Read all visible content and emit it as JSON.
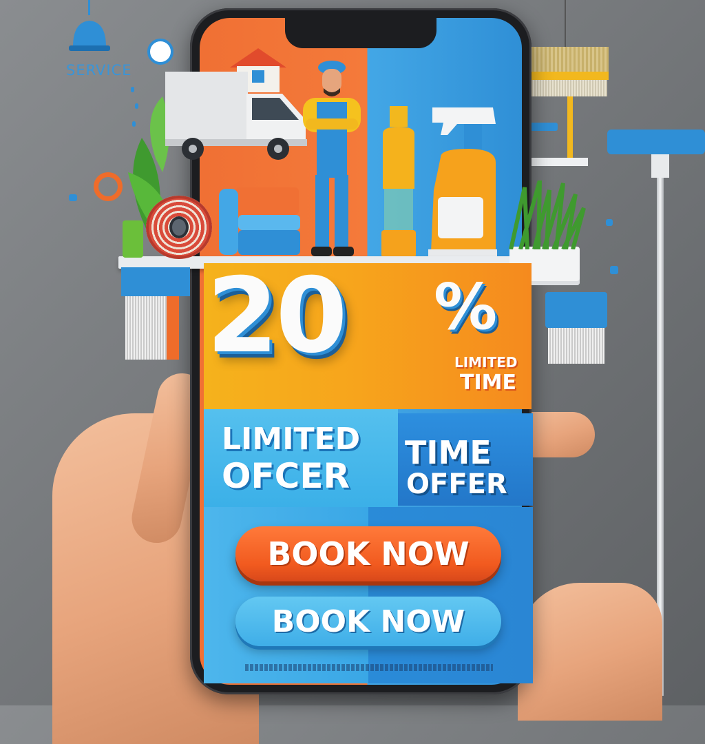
{
  "header": {
    "service_label": "SERVICE"
  },
  "promo": {
    "discount_value": "20",
    "discount_symbol": "%",
    "tag_line1": "LIMITED",
    "tag_line2": "TIME",
    "left_line1": "LIMITED",
    "left_line2": "OFCER",
    "right_line1": "TIME",
    "right_line2": "OFFER"
  },
  "buttons": {
    "primary_label": "BOOK NOW",
    "secondary_label": "BOOK NOW"
  },
  "icons": {
    "lamp": "lamp-icon",
    "truck": "truck-icon",
    "house": "house-icon",
    "worker": "worker-icon",
    "spray_bottle": "spray-bottle-icon",
    "mop": "mop-icon",
    "broom": "broom-icon",
    "plant": "plant-icon"
  },
  "colors": {
    "accent_orange": "#f15a1f",
    "accent_blue": "#2f8fd6",
    "accent_yellow": "#f5b21c"
  }
}
